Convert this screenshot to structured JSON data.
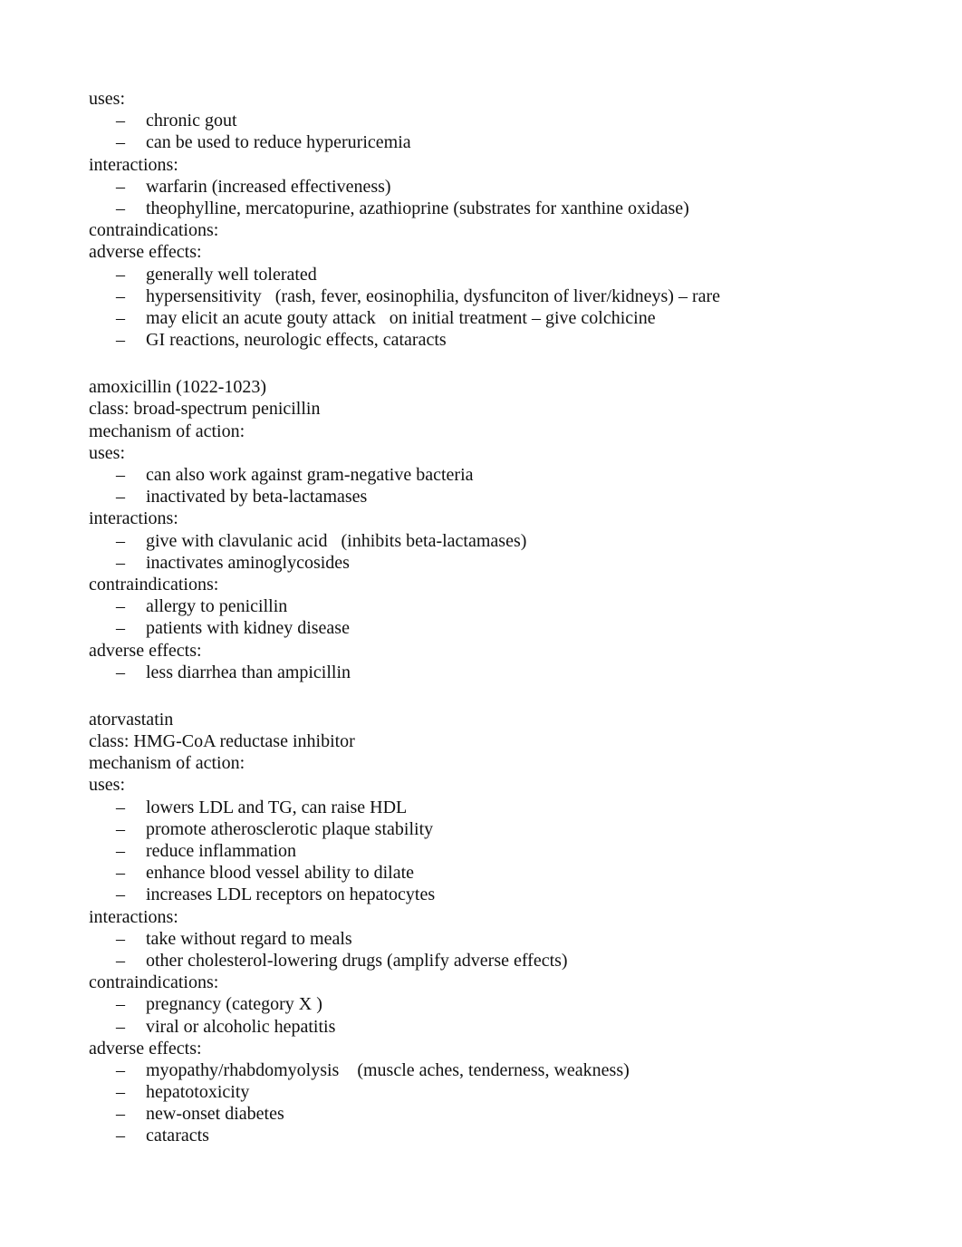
{
  "sections": [
    {
      "title": null,
      "class_line": null,
      "mechanism": null,
      "groups": [
        {
          "label": "uses:",
          "items": [
            "chronic gout",
            "can be used to reduce hyperuricemia"
          ]
        },
        {
          "label": "interactions:",
          "items": [
            "warfarin (increased effectiveness)",
            "theophylline, mercatopurine, azathioprine (substrates for xanthine oxidase)"
          ]
        },
        {
          "label": "contraindications:",
          "items": []
        },
        {
          "label": "adverse effects:",
          "items": [
            "generally well tolerated",
            "hypersensitivity   (rash, fever, eosinophilia, dysfunciton of liver/kidneys) – rare",
            "may elicit an acute gouty attack   on initial treatment – give colchicine",
            "GI reactions, neurologic effects, cataracts"
          ]
        }
      ]
    },
    {
      "title": "amoxicillin (1022-1023)",
      "class_line": "class: broad-spectrum penicillin",
      "mechanism": "mechanism of action:",
      "groups": [
        {
          "label": "uses:",
          "items": [
            "can also work against gram-negative bacteria",
            "inactivated by beta-lactamases"
          ]
        },
        {
          "label": "interactions:",
          "items": [
            "give with clavulanic acid   (inhibits beta-lactamases)",
            "inactivates aminoglycosides"
          ]
        },
        {
          "label": "contraindications:",
          "items": [
            "allergy to penicillin",
            "patients with kidney disease"
          ]
        },
        {
          "label": "adverse effects:",
          "items": [
            "less diarrhea than ampicillin"
          ]
        }
      ]
    },
    {
      "title": "atorvastatin",
      "class_line": "class: HMG-CoA reductase inhibitor",
      "mechanism": "mechanism of action:",
      "groups": [
        {
          "label": "uses:",
          "items": [
            "lowers LDL and TG, can raise HDL",
            "promote atherosclerotic plaque stability",
            "reduce inflammation",
            "enhance blood vessel ability to dilate",
            "increases LDL receptors on hepatocytes"
          ]
        },
        {
          "label": "interactions:",
          "items": [
            "take without regard to meals",
            "other cholesterol-lowering drugs (amplify adverse effects)"
          ]
        },
        {
          "label": "contraindications:",
          "items": [
            "pregnancy (category X )",
            "viral or alcoholic hepatitis"
          ]
        },
        {
          "label": "adverse effects:",
          "items": [
            "myopathy/rhabdomyolysis    (muscle aches, tenderness, weakness)",
            "hepatotoxicity",
            "new-onset diabetes",
            "cataracts"
          ]
        }
      ]
    }
  ],
  "bullet_glyph": "–"
}
